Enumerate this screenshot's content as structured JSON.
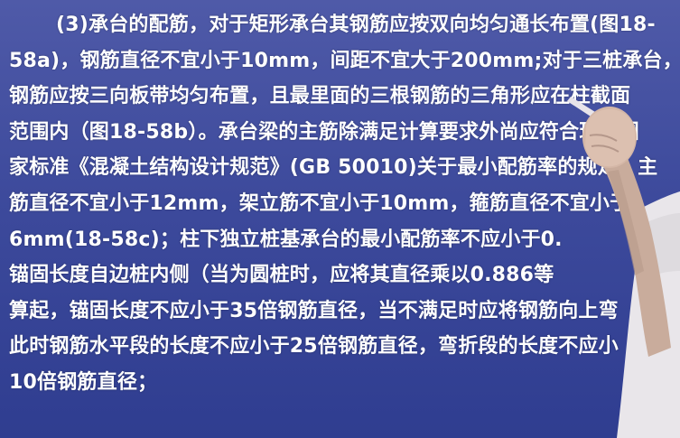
{
  "lines": [
    "(3)承台的配筋，对于矩形承台其钢筋应按双向均匀通长布置(图18-",
    "58a)，钢筋直径不宜小于10mm，间距不宜大于200mm;对于三桩承台，",
    "钢筋应按三向板带均匀布置，且最里面的三根钢筋的三角形应在柱截面",
    "范围内（图18-58b）。承台梁的主筋除满足计算要求外尚应符合现行国",
    "家标准《混凝土结构设计规范》(GB 50010)关于最小配筋率的规定，主",
    "筋直径不宜小于12mm，架立筋不宜小于10mm，箍筋直径不宜小于",
    "6mm(18-58c)；柱下独立桩基承台的最小配筋率不应小于0.",
    "锚固长度自边桩内侧（当为圆桩时，应将其直径乘以0.886等",
    "算起，锚固长度不应小于35倍钢筋直径，当不满足时应将钢筋向上弯",
    "此时钢筋水平段的长度不应小于25倍钢筋直径，弯折段的长度不应小",
    "10倍钢筋直径；"
  ]
}
